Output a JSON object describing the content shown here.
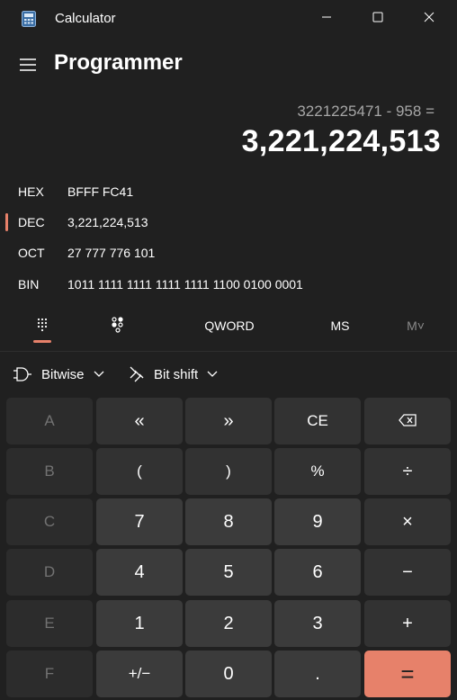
{
  "window": {
    "title": "Calculator",
    "icons": {
      "app": "calculator-icon",
      "minimize": "minimize-icon",
      "maximize": "maximize-icon",
      "close": "close-icon"
    }
  },
  "header": {
    "mode": "Programmer",
    "menu_icon": "hamburger-icon"
  },
  "display": {
    "expression": "3221225471 - 958 =",
    "result": "3,221,224,513"
  },
  "radix": [
    {
      "label": "HEX",
      "value": "BFFF FC41",
      "selected": false
    },
    {
      "label": "DEC",
      "value": "3,221,224,513",
      "selected": true
    },
    {
      "label": "OCT",
      "value": "27 777 776 101",
      "selected": false
    },
    {
      "label": "BIN",
      "value": "1011 1111 1111 1111 1111 1100 0100 0001",
      "selected": false
    }
  ],
  "tabs": {
    "keypad_icon": "full-keypad-icon",
    "bit_toggle_icon": "bit-toggle-icon",
    "word_size": "QWORD",
    "ms": "MS",
    "mv": "M˅"
  },
  "toolbar": {
    "bitwise": "Bitwise",
    "bitshift": "Bit shift",
    "bitwise_icon": "logic-gate-icon",
    "bitshift_icon": "bit-shift-icon"
  },
  "keys": {
    "r0": [
      "A",
      "«",
      "»",
      "CE",
      "⌫"
    ],
    "r1": [
      "B",
      "(",
      ")",
      "%",
      "÷"
    ],
    "r2": [
      "C",
      "7",
      "8",
      "9",
      "×"
    ],
    "r3": [
      "D",
      "4",
      "5",
      "6",
      "−"
    ],
    "r4": [
      "E",
      "1",
      "2",
      "3",
      "+"
    ],
    "r5": [
      "F",
      "+/−",
      "0",
      ".",
      "="
    ]
  },
  "colors": {
    "accent": "#e7816a",
    "background": "#202020",
    "number_key": "#3b3b3b",
    "operator_key": "#323232",
    "disabled_key": "#2c2c2c"
  }
}
